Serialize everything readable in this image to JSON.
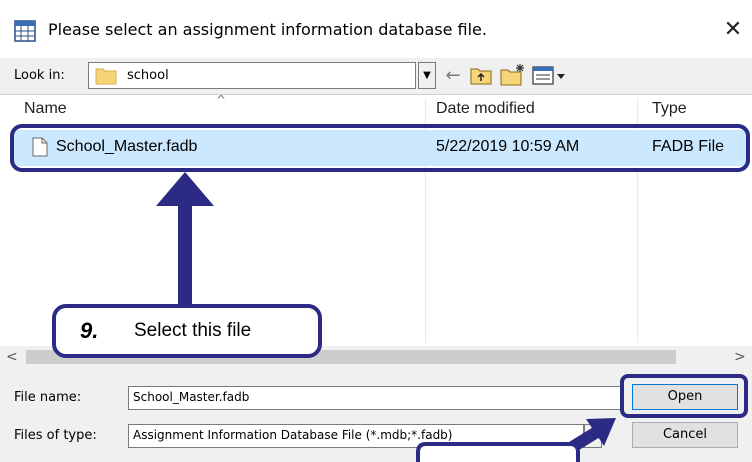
{
  "dialog": {
    "title": "Please select an assignment information database file.",
    "close_glyph": "✕"
  },
  "toolbar": {
    "lookin_label": "Look in:",
    "lookin_value": "school",
    "dropdown_glyph": "▼",
    "back_glyph": "←",
    "up_glyph": "⇧",
    "icons": [
      "back-arrow-icon",
      "up-folder-icon",
      "new-folder-icon",
      "view-menu-icon"
    ]
  },
  "list": {
    "columns": [
      "Name",
      "Date modified",
      "Type"
    ],
    "rows": [
      {
        "name": "School_Master.fadb",
        "date": "5/22/2019 10:59 AM",
        "type": "FADB File"
      }
    ]
  },
  "scroll": {
    "left_glyph": "<",
    "right_glyph": ">"
  },
  "form": {
    "filename_label": "File name:",
    "filename_value": "School_Master.fadb",
    "filetype_label": "Files of type:",
    "filetype_value": "Assignment Information Database File (*.mdb;*.fadb)",
    "open_label": "Open",
    "cancel_label": "Cancel"
  },
  "annotation": {
    "step_number": "9.",
    "step_text": "Select this file",
    "color": "#2b2a85"
  },
  "colors": {
    "selection": "#cce8ff",
    "callout": "#2b2a85"
  }
}
